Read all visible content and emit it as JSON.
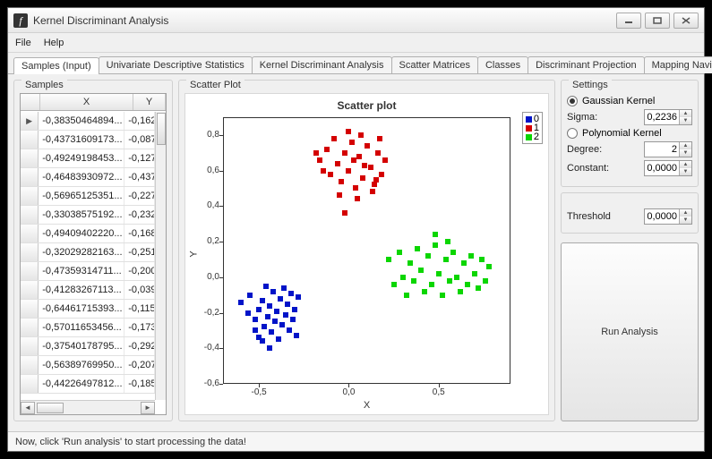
{
  "window": {
    "title": "Kernel Discriminant Analysis"
  },
  "menu": {
    "file": "File",
    "help": "Help"
  },
  "tabs": [
    "Samples (Input)",
    "Univariate Descriptive Statistics",
    "Kernel Discriminant Analysis",
    "Scatter Matrices",
    "Classes",
    "Discriminant Projection",
    "Mapping Navigation"
  ],
  "samples": {
    "title": "Samples",
    "columns": [
      "X",
      "Y"
    ],
    "rows": [
      {
        "x": "-0,38350464894...",
        "y": "-0,162",
        "selected": true,
        "current": true
      },
      {
        "x": "-0,43731609173...",
        "y": "-0,087"
      },
      {
        "x": "-0,49249198453...",
        "y": "-0,127"
      },
      {
        "x": "-0,46483930972...",
        "y": "-0,437"
      },
      {
        "x": "-0,56965125351...",
        "y": "-0,227"
      },
      {
        "x": "-0,33038575192...",
        "y": "-0,232"
      },
      {
        "x": "-0,49409402220...",
        "y": "-0,168"
      },
      {
        "x": "-0,32029282163...",
        "y": "-0,251"
      },
      {
        "x": "-0,47359314711...",
        "y": "-0,200"
      },
      {
        "x": "-0,41283267113...",
        "y": "-0,039"
      },
      {
        "x": "-0,64461715393...",
        "y": "-0,115"
      },
      {
        "x": "-0,57011653456...",
        "y": "-0,173"
      },
      {
        "x": "-0,37540178795...",
        "y": "-0,292"
      },
      {
        "x": "-0,56389769950...",
        "y": "-0,207"
      },
      {
        "x": "-0,44226497812...",
        "y": "-0,185"
      }
    ]
  },
  "plot": {
    "title": "Scatter Plot",
    "chart_title": "Scatter plot",
    "xlabel": "X",
    "ylabel": "Y",
    "legend": [
      "0",
      "1",
      "2"
    ]
  },
  "settings": {
    "title": "Settings",
    "gaussian_label": "Gaussian Kernel",
    "sigma_label": "Sigma:",
    "sigma_value": "0,2236",
    "poly_label": "Polynomial Kernel",
    "degree_label": "Degree:",
    "degree_value": "2",
    "constant_label": "Constant:",
    "constant_value": "0,0000",
    "threshold_label": "Threshold",
    "threshold_value": "0,0000",
    "run_label": "Run Analysis"
  },
  "status": "Now, click 'Run analysis' to start processing the data!",
  "chart_data": {
    "type": "scatter",
    "title": "Scatter plot",
    "xlabel": "X",
    "ylabel": "Y",
    "xlim": [
      -0.7,
      0.9
    ],
    "ylim": [
      -0.6,
      0.9
    ],
    "xticks": [
      -0.5,
      0.0,
      0.5
    ],
    "yticks": [
      -0.6,
      -0.4,
      -0.2,
      0.0,
      0.2,
      0.4,
      0.6,
      0.8
    ],
    "series": [
      {
        "name": "0",
        "color": "#0014c8",
        "points": [
          [
            -0.6,
            -0.14
          ],
          [
            -0.56,
            -0.2
          ],
          [
            -0.55,
            -0.1
          ],
          [
            -0.52,
            -0.24
          ],
          [
            -0.5,
            -0.18
          ],
          [
            -0.5,
            -0.34
          ],
          [
            -0.48,
            -0.13
          ],
          [
            -0.47,
            -0.28
          ],
          [
            -0.46,
            -0.05
          ],
          [
            -0.45,
            -0.22
          ],
          [
            -0.44,
            -0.16
          ],
          [
            -0.43,
            -0.31
          ],
          [
            -0.42,
            -0.08
          ],
          [
            -0.41,
            -0.25
          ],
          [
            -0.4,
            -0.19
          ],
          [
            -0.39,
            -0.35
          ],
          [
            -0.38,
            -0.12
          ],
          [
            -0.37,
            -0.27
          ],
          [
            -0.36,
            -0.06
          ],
          [
            -0.35,
            -0.21
          ],
          [
            -0.34,
            -0.15
          ],
          [
            -0.33,
            -0.3
          ],
          [
            -0.32,
            -0.09
          ],
          [
            -0.31,
            -0.24
          ],
          [
            -0.3,
            -0.18
          ],
          [
            -0.29,
            -0.33
          ],
          [
            -0.28,
            -0.11
          ],
          [
            -0.52,
            -0.3
          ],
          [
            -0.48,
            -0.36
          ],
          [
            -0.44,
            -0.4
          ]
        ]
      },
      {
        "name": "1",
        "color": "#d40000",
        "points": [
          [
            -0.16,
            0.66
          ],
          [
            -0.12,
            0.72
          ],
          [
            -0.1,
            0.58
          ],
          [
            -0.08,
            0.78
          ],
          [
            -0.06,
            0.64
          ],
          [
            -0.04,
            0.54
          ],
          [
            -0.02,
            0.7
          ],
          [
            0.0,
            0.6
          ],
          [
            0.02,
            0.76
          ],
          [
            0.04,
            0.5
          ],
          [
            0.06,
            0.68
          ],
          [
            0.08,
            0.56
          ],
          [
            0.1,
            0.74
          ],
          [
            0.12,
            0.62
          ],
          [
            0.14,
            0.52
          ],
          [
            0.16,
            0.7
          ],
          [
            0.18,
            0.58
          ],
          [
            0.2,
            0.66
          ],
          [
            -0.14,
            0.6
          ],
          [
            -0.05,
            0.46
          ],
          [
            0.0,
            0.82
          ],
          [
            0.05,
            0.44
          ],
          [
            0.07,
            0.8
          ],
          [
            0.13,
            0.48
          ],
          [
            0.17,
            0.78
          ],
          [
            -0.18,
            0.7
          ],
          [
            -0.02,
            0.36
          ],
          [
            0.03,
            0.66
          ],
          [
            0.09,
            0.63
          ],
          [
            0.15,
            0.55
          ]
        ]
      },
      {
        "name": "2",
        "color": "#0bd600",
        "points": [
          [
            0.22,
            0.1
          ],
          [
            0.25,
            -0.04
          ],
          [
            0.28,
            0.14
          ],
          [
            0.3,
            0.0
          ],
          [
            0.32,
            -0.1
          ],
          [
            0.34,
            0.08
          ],
          [
            0.36,
            -0.02
          ],
          [
            0.38,
            0.16
          ],
          [
            0.4,
            0.04
          ],
          [
            0.42,
            -0.08
          ],
          [
            0.44,
            0.12
          ],
          [
            0.46,
            -0.04
          ],
          [
            0.48,
            0.18
          ],
          [
            0.5,
            0.02
          ],
          [
            0.52,
            -0.1
          ],
          [
            0.54,
            0.1
          ],
          [
            0.56,
            -0.02
          ],
          [
            0.58,
            0.14
          ],
          [
            0.6,
            0.0
          ],
          [
            0.62,
            -0.08
          ],
          [
            0.64,
            0.08
          ],
          [
            0.66,
            -0.04
          ],
          [
            0.68,
            0.12
          ],
          [
            0.7,
            0.02
          ],
          [
            0.72,
            -0.06
          ],
          [
            0.74,
            0.1
          ],
          [
            0.76,
            -0.02
          ],
          [
            0.78,
            0.06
          ],
          [
            0.48,
            0.24
          ],
          [
            0.55,
            0.2
          ]
        ]
      }
    ]
  }
}
